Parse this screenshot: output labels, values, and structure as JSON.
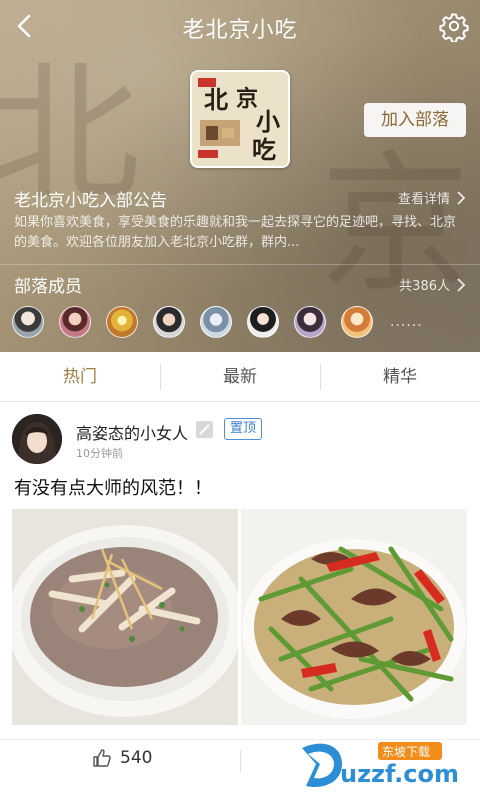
{
  "header": {
    "title": "老北京小吃",
    "cover_text": "北京小吃",
    "join_label": "加入部落"
  },
  "notice": {
    "title": "老北京小吃入部公告",
    "more_label": "查看详情",
    "body": "如果你喜欢美食，享受美食的乐趣就和我一起去探寻它的足迹吧，寻找、北京的美食。欢迎各位朋友加入老北京小吃群，群内..."
  },
  "members": {
    "title": "部落成员",
    "count_label": "共386人",
    "more_dots": "......",
    "avatars": [
      "member-1",
      "member-2",
      "member-3",
      "member-4",
      "member-5",
      "member-6",
      "member-7",
      "member-8"
    ]
  },
  "tabs": [
    {
      "label": "热门",
      "active": true
    },
    {
      "label": "最新",
      "active": false
    },
    {
      "label": "精华",
      "active": false
    }
  ],
  "post": {
    "author": "高姿态的小女人",
    "pin_label": "置顶",
    "time": "10分钟前",
    "text": "有没有点大师的风范！！",
    "likes": "540"
  },
  "watermark": {
    "brand": "uzzf.com",
    "tag": "东坡下载"
  },
  "colors": {
    "accent": "#a07d45",
    "pin_blue": "#3a7fcf"
  }
}
